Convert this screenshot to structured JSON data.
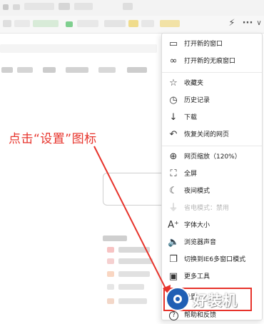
{
  "toolbar": {
    "icons": [
      "lightning-icon",
      "more-icon",
      "chevron-down-icon"
    ],
    "more_label": "···",
    "chevron_label": "∨",
    "lightning_label": "⚡"
  },
  "menu": {
    "items": [
      {
        "label": "打开新的窗口",
        "icon": "window-icon",
        "glyph": "▭"
      },
      {
        "label": "打开新的无痕窗口",
        "icon": "incognito-icon",
        "glyph": "∞"
      },
      {
        "label": "收藏夹",
        "icon": "favorites-icon",
        "glyph": "☆"
      },
      {
        "label": "历史记录",
        "icon": "history-icon",
        "glyph": "◷"
      },
      {
        "label": "下载",
        "icon": "download-icon",
        "glyph": "↓"
      },
      {
        "label": "恢复关闭的网页",
        "icon": "restore-icon",
        "glyph": "↶"
      },
      {
        "label": "网页缩放（120%）",
        "icon": "zoom-icon",
        "glyph": "⊕"
      },
      {
        "label": "全屏",
        "icon": "fullscreen-icon",
        "glyph": "⛶"
      },
      {
        "label": "夜间模式",
        "icon": "night-mode-icon",
        "glyph": "☾"
      },
      {
        "label": "省电模式：禁用",
        "icon": "power-save-icon",
        "glyph": "⏚"
      },
      {
        "label": "字体大小",
        "icon": "font-size-icon",
        "glyph": "A⁺"
      },
      {
        "label": "浏览器声音",
        "icon": "sound-icon",
        "glyph": "🔈"
      },
      {
        "label": "切换到IE6多窗口模式",
        "icon": "ie6-window-icon",
        "glyph": "❐"
      },
      {
        "label": "更多工具",
        "icon": "tools-icon",
        "glyph": "▣"
      },
      {
        "label": "设置",
        "icon": "settings-icon",
        "glyph": "⚙"
      },
      {
        "label": "帮助和反馈",
        "icon": "help-icon",
        "glyph": "?"
      }
    ]
  },
  "annotation": {
    "text": "点击“设置”图标",
    "color": "#e7332b"
  },
  "watermark": {
    "text": "好装机"
  }
}
